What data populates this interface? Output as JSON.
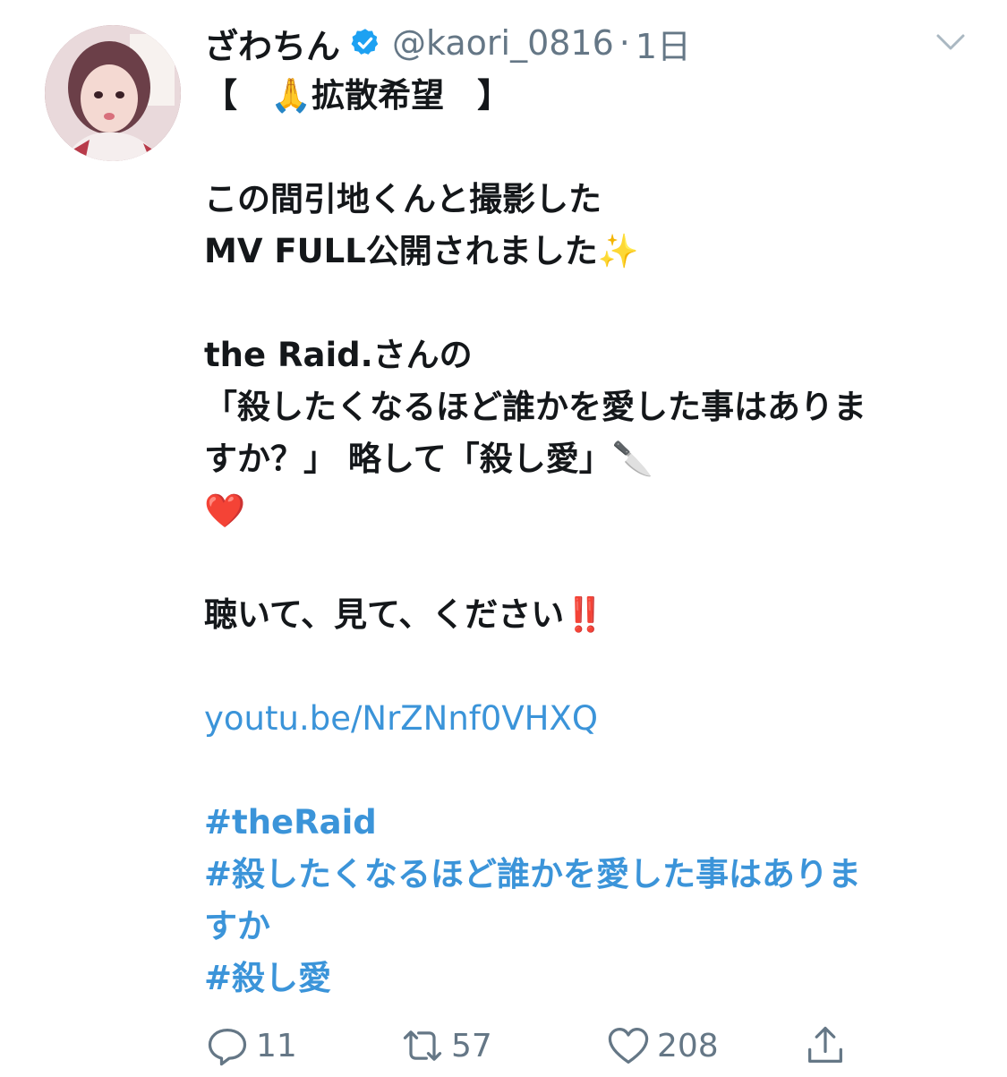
{
  "tweet": {
    "display_name": "ざわちん",
    "handle": "@kaori_0816",
    "separator": "·",
    "time": "1日",
    "lines": [
      {
        "text": "【　🙏拡散希望　】",
        "kind": "text"
      },
      {
        "text": "",
        "kind": "text"
      },
      {
        "text": "この間引地くんと撮影した",
        "kind": "text"
      },
      {
        "text": "MV FULL公開されました✨",
        "kind": "text"
      },
      {
        "text": "",
        "kind": "text"
      },
      {
        "text": "the Raid.さんの",
        "kind": "text"
      },
      {
        "text": "「殺したくなるほど誰かを愛した事はありま",
        "kind": "text"
      },
      {
        "text": "すか？」 略して「殺し愛」🔪",
        "kind": "text"
      },
      {
        "text": "❤️",
        "kind": "text"
      },
      {
        "text": "",
        "kind": "text"
      },
      {
        "text": "聴いて、見て、ください‼️",
        "kind": "text"
      },
      {
        "text": "",
        "kind": "text"
      },
      {
        "text": "youtu.be/NrZNnf0VHXQ",
        "kind": "link"
      },
      {
        "text": "",
        "kind": "text"
      },
      {
        "text": "#theRaid",
        "kind": "hashtag"
      },
      {
        "text": "#殺したくなるほど誰かを愛した事はありま",
        "kind": "hashtag"
      },
      {
        "text": "すか",
        "kind": "hashtag"
      },
      {
        "text": "#殺し愛",
        "kind": "hashtag"
      }
    ]
  },
  "actions": {
    "reply_count": "11",
    "retweet_count": "57",
    "like_count": "208"
  },
  "icons": {
    "verified": "verified-badge-icon",
    "caret": "chevron-down-icon",
    "reply": "reply-icon",
    "retweet": "retweet-icon",
    "like": "heart-icon",
    "share": "share-icon"
  },
  "colors": {
    "link": "#3b94d9",
    "verified": "#1da1f2",
    "muted": "#657786",
    "text": "#14171a"
  }
}
